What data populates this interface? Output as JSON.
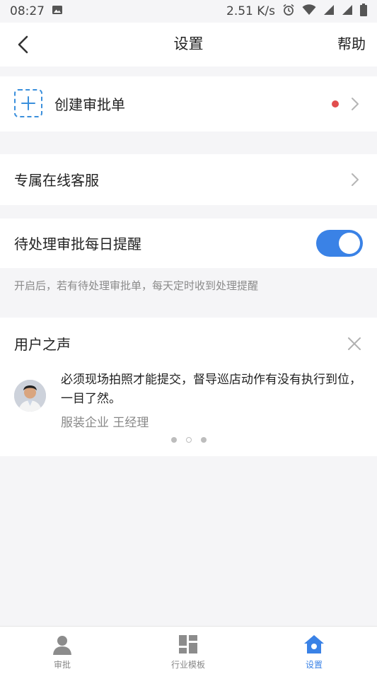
{
  "status_bar": {
    "time": "08:27",
    "net_speed": "2.51 K/s"
  },
  "header": {
    "title": "设置",
    "help_label": "帮助"
  },
  "create_approval": {
    "label": "创建审批单"
  },
  "customer_service": {
    "label": "专属在线客服"
  },
  "daily_reminder": {
    "label": "待处理审批每日提醒",
    "enabled": true,
    "hint": "开启后，若有待处理审批单，每天定时收到处理提醒"
  },
  "user_voice": {
    "title": "用户之声",
    "quote": "必须现场拍照才能提交，督导巡店动作有没有执行到位，一目了然。",
    "author": "服装企业 王经理",
    "page_count": 3,
    "current_page": 2
  },
  "tabs": [
    {
      "label": "审批",
      "icon": "person-icon",
      "active": false
    },
    {
      "label": "行业模板",
      "icon": "grid-icon",
      "active": false
    },
    {
      "label": "设置",
      "icon": "house-icon",
      "active": true
    }
  ],
  "colors": {
    "accent": "#3a82e6",
    "badge_red": "#e14d4d",
    "background": "#f5f5f7"
  }
}
